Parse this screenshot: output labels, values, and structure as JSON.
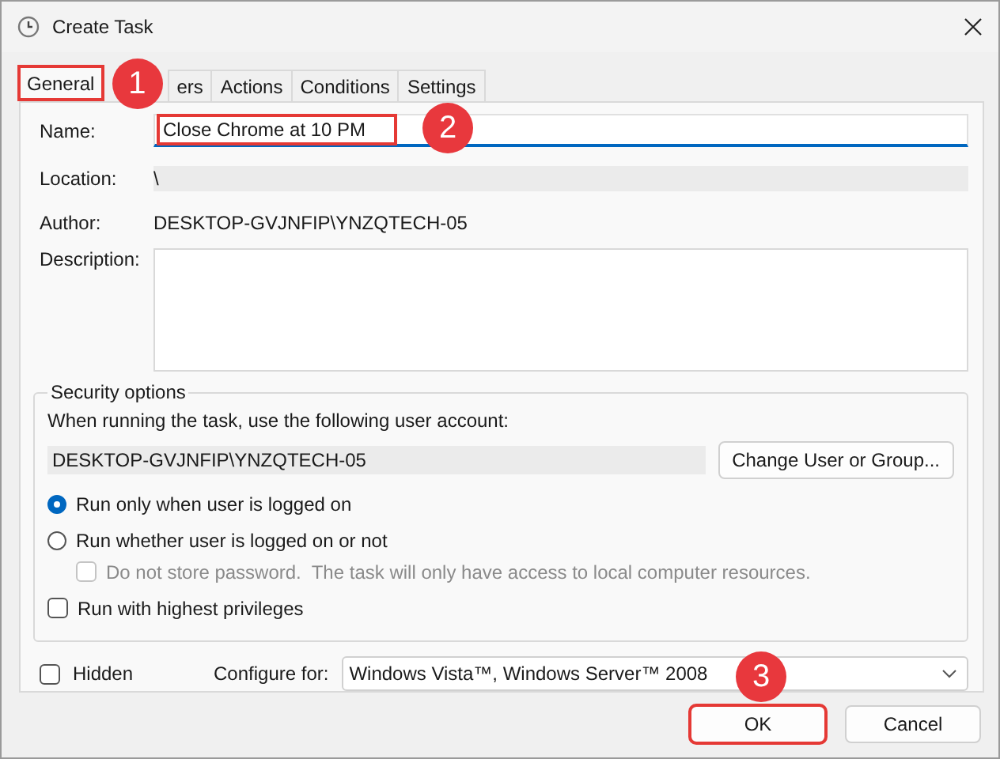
{
  "window": {
    "title": "Create Task"
  },
  "tabs": [
    {
      "label": "General",
      "selected": true,
      "highlighted": true
    },
    {
      "label": "ers",
      "selected": false,
      "highlighted": false
    },
    {
      "label": "Actions",
      "selected": false,
      "highlighted": false
    },
    {
      "label": "Conditions",
      "selected": false,
      "highlighted": false
    },
    {
      "label": "Settings",
      "selected": false,
      "highlighted": false
    }
  ],
  "fields": [
    {
      "kind": "input",
      "label": "Name:",
      "value": "Close Chrome at 10 PM",
      "highlighted": true
    },
    {
      "kind": "readonly",
      "label": "Location:",
      "value": "\\"
    },
    {
      "kind": "text",
      "label": "Author:",
      "value": "DESKTOP-GVJNFIP\\YNZQTECH-05"
    },
    {
      "kind": "textarea",
      "label": "Description:"
    }
  ],
  "security": {
    "title": "Security options",
    "prompt": "When running the task, use the following user account:",
    "account": "DESKTOP-GVJNFIP\\YNZQTECH-05",
    "change_button": "Change User or Group...",
    "options": [
      {
        "kind": "radio",
        "label": "Run only when user is logged on",
        "checked": true,
        "disabled": false
      },
      {
        "kind": "radio",
        "label": "Run whether user is logged on or not",
        "checked": false,
        "disabled": false
      },
      {
        "kind": "checkbox",
        "label": "Do not store password.  The task will only have access to local computer resources.",
        "checked": false,
        "disabled": true
      },
      {
        "kind": "checkbox",
        "label": "Run with highest privileges",
        "checked": false,
        "disabled": false
      }
    ]
  },
  "hidden": {
    "label": "Hidden",
    "checked": false
  },
  "configure": {
    "label": "Configure for:",
    "value": "Windows Vista™, Windows Server™ 2008"
  },
  "buttons": [
    {
      "label": "OK",
      "highlighted": true
    },
    {
      "label": "Cancel",
      "highlighted": false
    }
  ],
  "annotations": [
    {
      "number": "1"
    },
    {
      "number": "2"
    },
    {
      "number": "3"
    }
  ]
}
